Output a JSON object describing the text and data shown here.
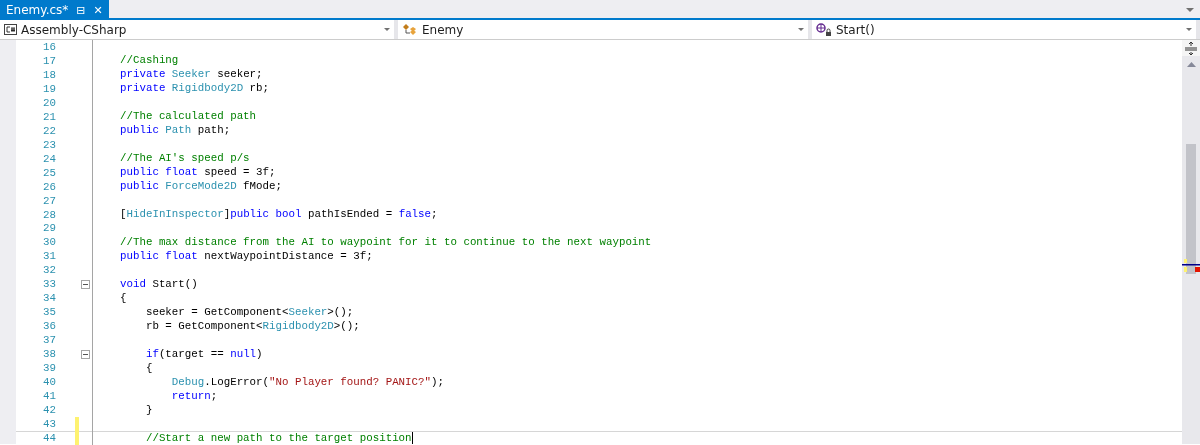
{
  "tab": {
    "label": "Enemy.cs*",
    "selected": true,
    "pin": "⊟",
    "close": "✕"
  },
  "navigation": [
    {
      "kind": "project",
      "label": "Assembly-CSharp"
    },
    {
      "kind": "class",
      "label": "Enemy"
    },
    {
      "kind": "method",
      "label": "Start()"
    }
  ],
  "editor": {
    "lines": [
      {
        "number": "16"
      },
      {
        "number": "17",
        "tokens": [
          {
            "kind": "comment",
            "text": "//Cashing"
          }
        ]
      },
      {
        "number": "18",
        "tokens": [
          {
            "kind": "keyword",
            "text": "private "
          },
          {
            "kind": "type",
            "text": "Seeker"
          },
          {
            "kind": "plain",
            "text": " seeker;"
          }
        ]
      },
      {
        "number": "19",
        "tokens": [
          {
            "kind": "keyword",
            "text": "private "
          },
          {
            "kind": "type",
            "text": "Rigidbody2D"
          },
          {
            "kind": "plain",
            "text": " rb;"
          }
        ]
      },
      {
        "number": "20"
      },
      {
        "number": "21",
        "tokens": [
          {
            "kind": "comment",
            "text": "//The calculated path"
          }
        ]
      },
      {
        "number": "22",
        "tokens": [
          {
            "kind": "keyword",
            "text": "public "
          },
          {
            "kind": "type",
            "text": "Path"
          },
          {
            "kind": "plain",
            "text": " path;"
          }
        ]
      },
      {
        "number": "23"
      },
      {
        "number": "24",
        "tokens": [
          {
            "kind": "comment",
            "text": "//The AI's speed p/s"
          }
        ]
      },
      {
        "number": "25",
        "tokens": [
          {
            "kind": "keyword",
            "text": "public float"
          },
          {
            "kind": "plain",
            "text": " speed = 3f;"
          }
        ]
      },
      {
        "number": "26",
        "tokens": [
          {
            "kind": "keyword",
            "text": "public "
          },
          {
            "kind": "type",
            "text": "ForceMode2D"
          },
          {
            "kind": "plain",
            "text": " fMode;"
          }
        ]
      },
      {
        "number": "27"
      },
      {
        "number": "28",
        "tokens": [
          {
            "kind": "plain",
            "text": "["
          },
          {
            "kind": "type",
            "text": "HideInInspector"
          },
          {
            "kind": "plain",
            "text": "]"
          },
          {
            "kind": "keyword",
            "text": "public bool"
          },
          {
            "kind": "plain",
            "text": " pathIsEnded = "
          },
          {
            "kind": "keyword",
            "text": "false"
          },
          {
            "kind": "plain",
            "text": ";"
          }
        ]
      },
      {
        "number": "29"
      },
      {
        "number": "30",
        "tokens": [
          {
            "kind": "comment",
            "text": "//The max distance from the AI to waypoint for it to continue to the next waypoint"
          }
        ]
      },
      {
        "number": "31",
        "tokens": [
          {
            "kind": "keyword",
            "text": "public float"
          },
          {
            "kind": "plain",
            "text": " nextWaypointDistance = 3f;"
          }
        ]
      },
      {
        "number": "32"
      },
      {
        "number": "33",
        "tokens": [
          {
            "kind": "keyword",
            "text": "void"
          },
          {
            "kind": "plain",
            "text": " Start()"
          }
        ],
        "fold": true
      },
      {
        "number": "34",
        "tokens": [
          {
            "kind": "plain",
            "text": "{"
          }
        ]
      },
      {
        "number": "35",
        "tokens": [
          {
            "kind": "plain",
            "text": "    seeker = GetComponent<"
          },
          {
            "kind": "type",
            "text": "Seeker"
          },
          {
            "kind": "plain",
            "text": ">();"
          }
        ]
      },
      {
        "number": "36",
        "tokens": [
          {
            "kind": "plain",
            "text": "    rb = GetComponent<"
          },
          {
            "kind": "type",
            "text": "Rigidbody2D"
          },
          {
            "kind": "plain",
            "text": ">();"
          }
        ]
      },
      {
        "number": "37"
      },
      {
        "number": "38",
        "tokens": [
          {
            "kind": "keyword",
            "text": "    if"
          },
          {
            "kind": "plain",
            "text": "(target == "
          },
          {
            "kind": "keyword",
            "text": "null"
          },
          {
            "kind": "plain",
            "text": ")"
          }
        ],
        "fold": true
      },
      {
        "number": "39",
        "tokens": [
          {
            "kind": "plain",
            "text": "    {"
          }
        ]
      },
      {
        "number": "40",
        "tokens": [
          {
            "kind": "type",
            "text": "        Debug"
          },
          {
            "kind": "plain",
            "text": ".LogError("
          },
          {
            "kind": "string",
            "text": "\"No Player found? PANIC?\""
          },
          {
            "kind": "plain",
            "text": ");"
          }
        ]
      },
      {
        "number": "41",
        "tokens": [
          {
            "kind": "keyword",
            "text": "        return"
          },
          {
            "kind": "plain",
            "text": ";"
          }
        ]
      },
      {
        "number": "42",
        "tokens": [
          {
            "kind": "plain",
            "text": "    }"
          }
        ]
      },
      {
        "number": "43",
        "modified": true
      },
      {
        "number": "44",
        "tokens": [
          {
            "kind": "comment",
            "text": "    //Start a new path to the target position"
          }
        ],
        "modified": true,
        "current": true
      }
    ]
  }
}
